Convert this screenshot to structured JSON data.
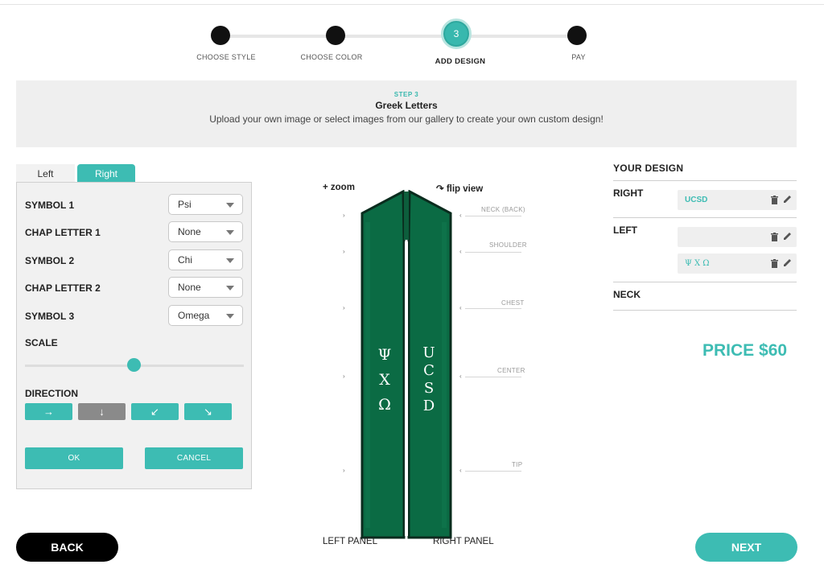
{
  "stepper": {
    "steps": [
      {
        "label": "CHOOSE STYLE",
        "state": "done"
      },
      {
        "label": "CHOOSE COLOR",
        "state": "done"
      },
      {
        "label": "ADD DESIGN",
        "state": "active",
        "number": "3"
      },
      {
        "label": "PAY",
        "state": "upcoming"
      }
    ]
  },
  "banner": {
    "kicker": "STEP 3",
    "title": "Greek Letters",
    "subtitle": "Upload your own image or select images from our gallery to create your own custom design!"
  },
  "tabs": {
    "left": "Left",
    "right": "Right",
    "active": "right"
  },
  "editor": {
    "fields": [
      {
        "label": "SYMBOL 1",
        "value": "Psi"
      },
      {
        "label": "CHAP LETTER 1",
        "value": "None"
      },
      {
        "label": "SYMBOL 2",
        "value": "Chi"
      },
      {
        "label": "CHAP LETTER 2",
        "value": "None"
      },
      {
        "label": "SYMBOL 3",
        "value": "Omega"
      }
    ],
    "scale_label": "SCALE",
    "scale_value": 0.5,
    "direction_label": "DIRECTION",
    "directions": [
      "→",
      "↓",
      "↙",
      "↘"
    ],
    "active_direction": "↓",
    "ok_label": "OK",
    "cancel_label": "CANCEL"
  },
  "stole": {
    "zoom_label": "+ zoom",
    "flip_label": "↷ flip view",
    "guides": [
      "NECK (BACK)",
      "SHOULDER",
      "CHEST",
      "CENTER",
      "TIP"
    ],
    "left_text": [
      "Ψ",
      "Χ",
      "Ω"
    ],
    "right_text": [
      "U",
      "C",
      "S",
      "D"
    ],
    "left_caption": "LEFT PANEL",
    "right_caption": "RIGHT PANEL",
    "stole_color": "#0b6b44"
  },
  "design": {
    "title": "YOUR DESIGN",
    "right_label": "RIGHT",
    "right_items": [
      "UCSD"
    ],
    "left_label": "LEFT",
    "left_items": [
      "",
      "Ψ Χ Ω"
    ],
    "neck_label": "NECK"
  },
  "price": "PRICE $60",
  "nav": {
    "back": "BACK",
    "next": "NEXT"
  },
  "colors": {
    "accent": "#3dbcb3",
    "stole": "#0b6b44"
  }
}
